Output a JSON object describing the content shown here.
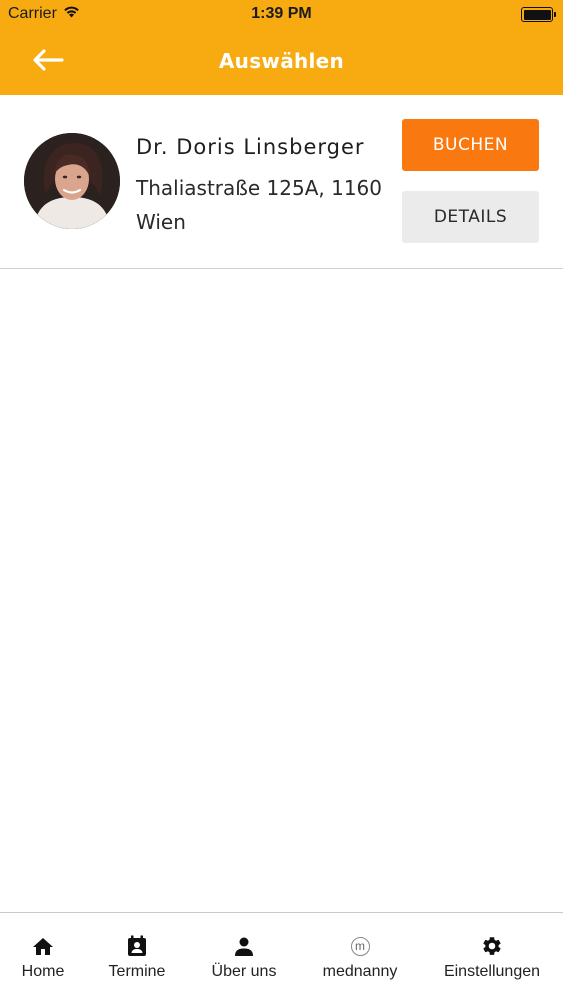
{
  "status_bar": {
    "carrier": "Carrier",
    "time": "1:39 PM",
    "battery_level": 1.0
  },
  "header": {
    "title": "Auswählen",
    "back_icon": "arrow-left-icon",
    "background_color": "#f7ab10"
  },
  "results": [
    {
      "name": "Dr. Doris Linsberger",
      "address": "Thaliastraße 125A, 1160 Wien",
      "book_label": "BUCHEN",
      "details_label": "DETAILS"
    }
  ],
  "colors": {
    "accent": "#f7ab10",
    "book_button": "#f9780f",
    "details_button": "#ebebeb"
  },
  "tab_bar": {
    "items": [
      {
        "label": "Home",
        "icon": "home-icon"
      },
      {
        "label": "Termine",
        "icon": "calendar-contact-icon"
      },
      {
        "label": "Über uns",
        "icon": "person-icon"
      },
      {
        "label": "mednanny",
        "icon": "mednanny-logo-icon"
      },
      {
        "label": "Einstellungen",
        "icon": "gear-icon"
      }
    ]
  }
}
